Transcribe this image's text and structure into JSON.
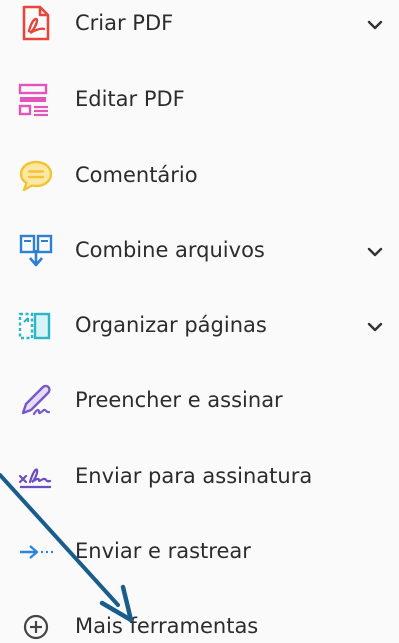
{
  "tools": [
    {
      "label": "Criar PDF",
      "icon": "create-pdf-icon",
      "expandable": true
    },
    {
      "label": "Editar PDF",
      "icon": "edit-pdf-icon",
      "expandable": false
    },
    {
      "label": "Comentário",
      "icon": "comment-icon",
      "expandable": false
    },
    {
      "label": "Combine arquivos",
      "icon": "combine-files-icon",
      "expandable": true
    },
    {
      "label": "Organizar páginas",
      "icon": "organize-pages-icon",
      "expandable": true
    },
    {
      "label": "Preencher e assinar",
      "icon": "fill-sign-icon",
      "expandable": false
    },
    {
      "label": "Enviar para assinatura",
      "icon": "send-for-signature-icon",
      "expandable": false
    },
    {
      "label": "Enviar e rastrear",
      "icon": "send-track-icon",
      "expandable": false
    },
    {
      "label": "Mais ferramentas",
      "icon": "more-tools-icon",
      "expandable": false
    }
  ],
  "annotation": {
    "type": "arrow",
    "target": "Mais ferramentas",
    "color": "#1a5c8c"
  },
  "colors": {
    "create": "#e5473d",
    "edit": "#e455b8",
    "comment": "#f2c433",
    "combine": "#2d7fd2",
    "organize": "#2cb5c6",
    "fill_sign": "#7a58c4",
    "signature": "#6a4ec2",
    "send_track": "#2d86d9",
    "text": "#2c2c2c"
  }
}
